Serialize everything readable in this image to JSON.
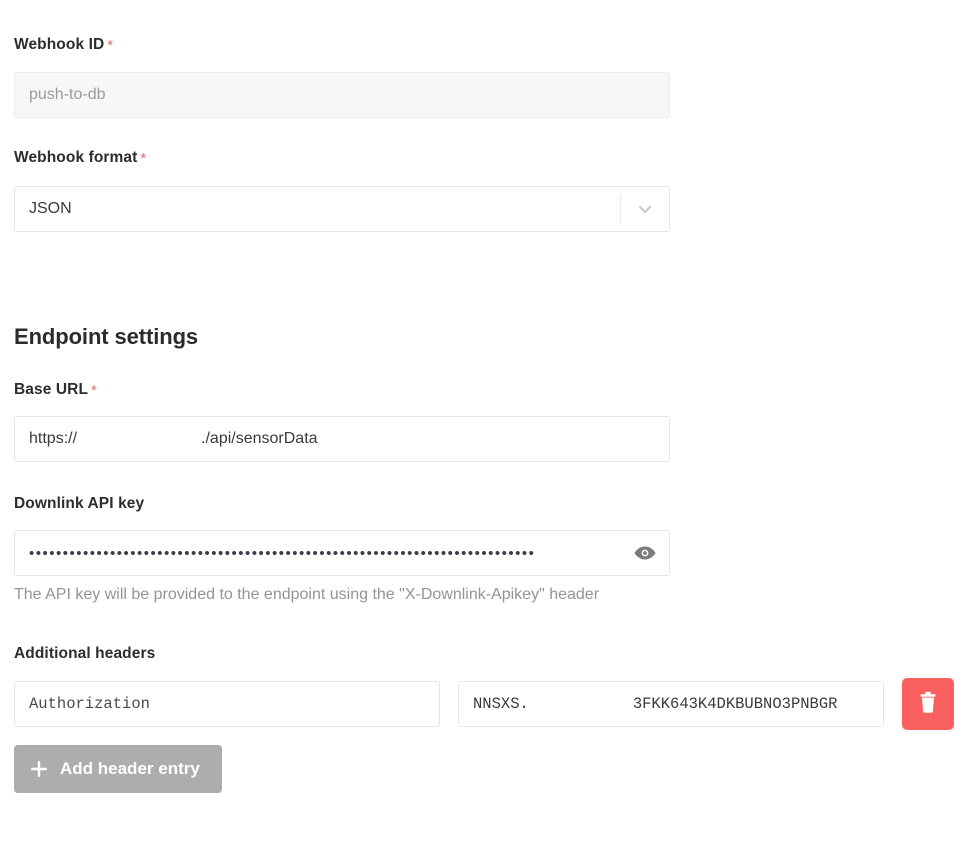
{
  "form": {
    "webhook_id": {
      "label": "Webhook ID",
      "required_marker": "*",
      "value": "push-to-db"
    },
    "webhook_format": {
      "label": "Webhook format",
      "required_marker": "*",
      "value": "JSON",
      "arrow_icon": "chevron-down-icon"
    }
  },
  "endpoint_settings": {
    "heading": "Endpoint settings",
    "base_url": {
      "label": "Base URL",
      "required_marker": "*",
      "value_prefix": "https://",
      "value_suffix": "./api/sensorData"
    },
    "downlink_api_key": {
      "label": "Downlink API key",
      "value": "•••••••••••••••••••••••••••••••••••••••••••••••••••••••••••••••••••••••••••",
      "reveal_icon": "eye-icon",
      "help_text": "The API key will be provided to the endpoint using the \"X-Downlink-Apikey\" header"
    },
    "additional_headers": {
      "label": "Additional headers",
      "rows": [
        {
          "key": "Authorization",
          "value_prefix": "NNSXS.",
          "value_suffix": "3FKK643K4DKBUBNO3PNBGR",
          "delete_icon": "trash-icon"
        }
      ],
      "add_button": {
        "label": "Add header entry",
        "icon": "plus-icon"
      }
    }
  },
  "colors": {
    "required_asterisk": "#ec6b6b",
    "delete_button": "#f9605f",
    "add_button": "#adadad",
    "help_text": "#949494",
    "disabled_field_bg": "#f7f7f7"
  }
}
